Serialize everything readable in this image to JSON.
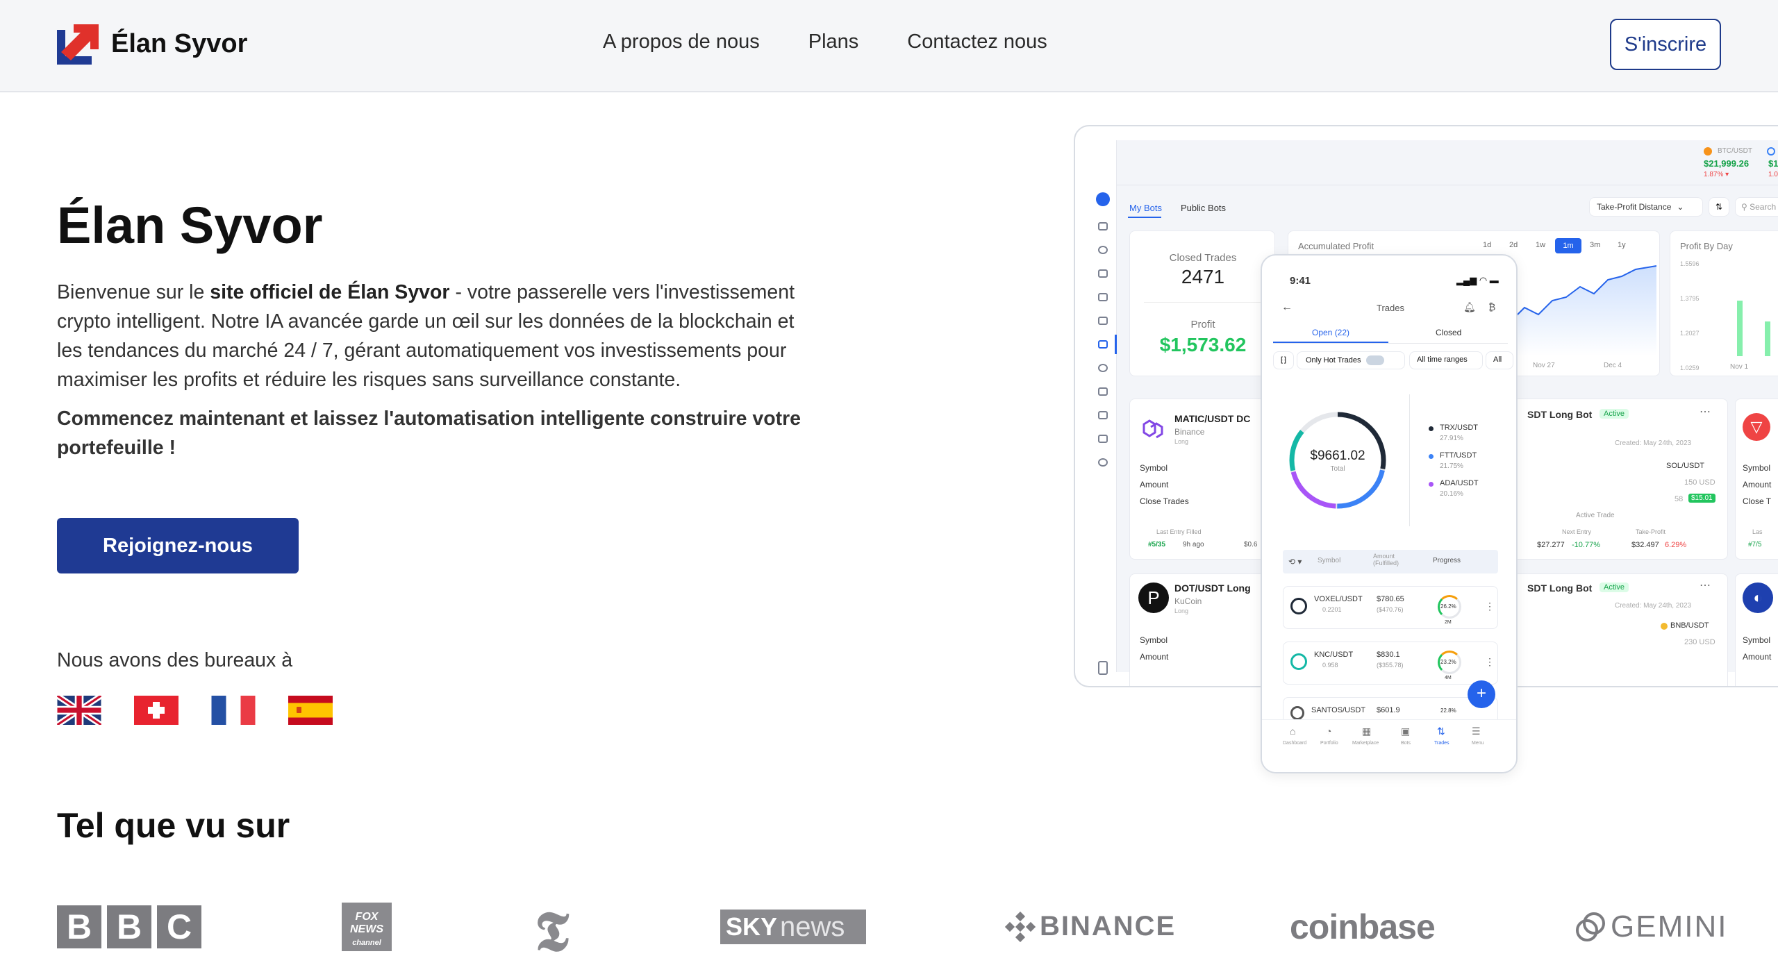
{
  "brand": {
    "name": "Élan Syvor",
    "accent": "#1f3a93",
    "logo_red": "#e0312b",
    "logo_blue": "#1f3a93"
  },
  "nav": {
    "items": [
      "A propos de nous",
      "Plans",
      "Contactez nous"
    ],
    "signup": "S'inscrire"
  },
  "hero": {
    "title": "Élan Syvor",
    "intro_prefix": "Bienvenue sur le ",
    "intro_bold": "site officiel de Élan Syvor",
    "intro_rest": " - votre passerelle vers l'investissement crypto intelligent. Notre IA avancée garde un œil sur les données de la blockchain et les tendances du marché 24 / 7, gérant automatiquement vos investissements pour maximiser les profits et réduire les risques sans surveillance constante.",
    "cta_text": "Commencez maintenant et laissez l'automatisation intelligente construire votre portefeuille !",
    "join_button": "Rejoignez-nous",
    "offices_label": "Nous avons des bureaux à",
    "flags": [
      "uk-flag",
      "switzerland-flag",
      "france-flag",
      "spain-flag"
    ]
  },
  "press": {
    "title": "Tel que vu sur",
    "logos": [
      "BBC",
      "FOX NEWS channel",
      "T",
      "SKY news",
      "BINANCE",
      "coinbase",
      "GEMINI"
    ]
  },
  "dashboard": {
    "tabs": [
      "My Bots",
      "Public Bots"
    ],
    "sort_select": "Take-Profit Distance",
    "search_placeholder": "Search",
    "ticker_pair": "BTC/USDT",
    "ticker_price": "$21,999.26",
    "ticker_change": "1.87% ▾",
    "ticker2_price": "$1",
    "ticker2_change": "1.0",
    "closed_trades_label": "Closed Trades",
    "closed_trades_value": "2471",
    "profit_label": "Profit",
    "profit_value": "$1,573.62",
    "accumulated_profit_label": "Accumulated Profit",
    "ranges": [
      "1d",
      "2d",
      "1w",
      "1m",
      "3m",
      "1y"
    ],
    "active_range": "1m",
    "profit_by_day_label": "Profit By Day",
    "pbd_ticks": [
      "1.5596",
      "1.3795",
      "1.2027",
      "1.0259"
    ],
    "pbd_xlabels": [
      "Nov 1",
      "N"
    ],
    "chart_xlabels": [
      "Nov 27",
      "Dec 4"
    ],
    "bots": [
      {
        "pair": "MATIC/USDT DC",
        "exchange": "Binance",
        "side": "Long",
        "rows": [
          "Symbol",
          "Amount",
          "Close Trades"
        ],
        "footer_label": "Last Entry Filled",
        "footer_val1": "#5/35",
        "footer_val2": "9h ago",
        "footer_val3": "$0.6"
      },
      {
        "pair": "DOT/USDT Long",
        "exchange": "KuCoin",
        "side": "Long",
        "rows": [
          "Symbol",
          "Amount"
        ]
      }
    ],
    "right_bots": [
      {
        "title": "SDT Long Bot",
        "status": "Active",
        "created": "Created: May 24th, 2023",
        "symbol": "SOL/USDT",
        "amount": "150 USD",
        "close": "58",
        "close_badge": "$15.01",
        "active_trade": "Active Trade",
        "next_entry_label": "Next Entry",
        "next_entry": "$27.277",
        "next_change": "-10.77%",
        "tp_label": "Take-Profit",
        "tp": "$32.497",
        "tp_change": "6.29%"
      },
      {
        "title": "SDT Long Bot",
        "status": "Active",
        "created": "Created: May 24th, 2023",
        "symbol": "BNB/USDT",
        "amount": "230 USD"
      }
    ],
    "far_right_labels": [
      "Symbol",
      "Amount",
      "Close T",
      "Las",
      "#7/5",
      "Symbol",
      "Amount"
    ]
  },
  "phone": {
    "time": "9:41",
    "title": "Trades",
    "tabs": [
      "Open (22)",
      "Closed"
    ],
    "filters": [
      "Only Hot Trades",
      "All time ranges",
      "All"
    ],
    "total_value": "$9661.02",
    "total_label": "Total",
    "legend": [
      {
        "pair": "TRX/USDT",
        "pct": "27.91%",
        "color": "#1f2937"
      },
      {
        "pair": "FTT/USDT",
        "pct": "21.75%",
        "color": "#3b82f6"
      },
      {
        "pair": "ADA/USDT",
        "pct": "20.16%",
        "color": "#a855f7"
      }
    ],
    "table_headers": [
      "Symbol",
      "Amount (Fulfilled)",
      "Progress"
    ],
    "trades": [
      {
        "pair": "VOXEL/USDT",
        "sub": "0.2201",
        "amount": "$780.65",
        "fulfilled": "($470.76)",
        "progress": "26.2%",
        "count": "2M"
      },
      {
        "pair": "KNC/USDT",
        "sub": "0.958",
        "amount": "$830.1",
        "fulfilled": "($355.78)",
        "progress": "23.2%",
        "count": "4M"
      },
      {
        "pair": "SANTOS/USDT",
        "sub": "",
        "amount": "$601.9",
        "fulfilled": "",
        "progress": "22.8%",
        "count": ""
      }
    ],
    "bottom_nav": [
      "Dashboard",
      "Portfolio",
      "Marketplace",
      "Bots",
      "Trades",
      "Menu"
    ],
    "active_nav": "Trades"
  }
}
